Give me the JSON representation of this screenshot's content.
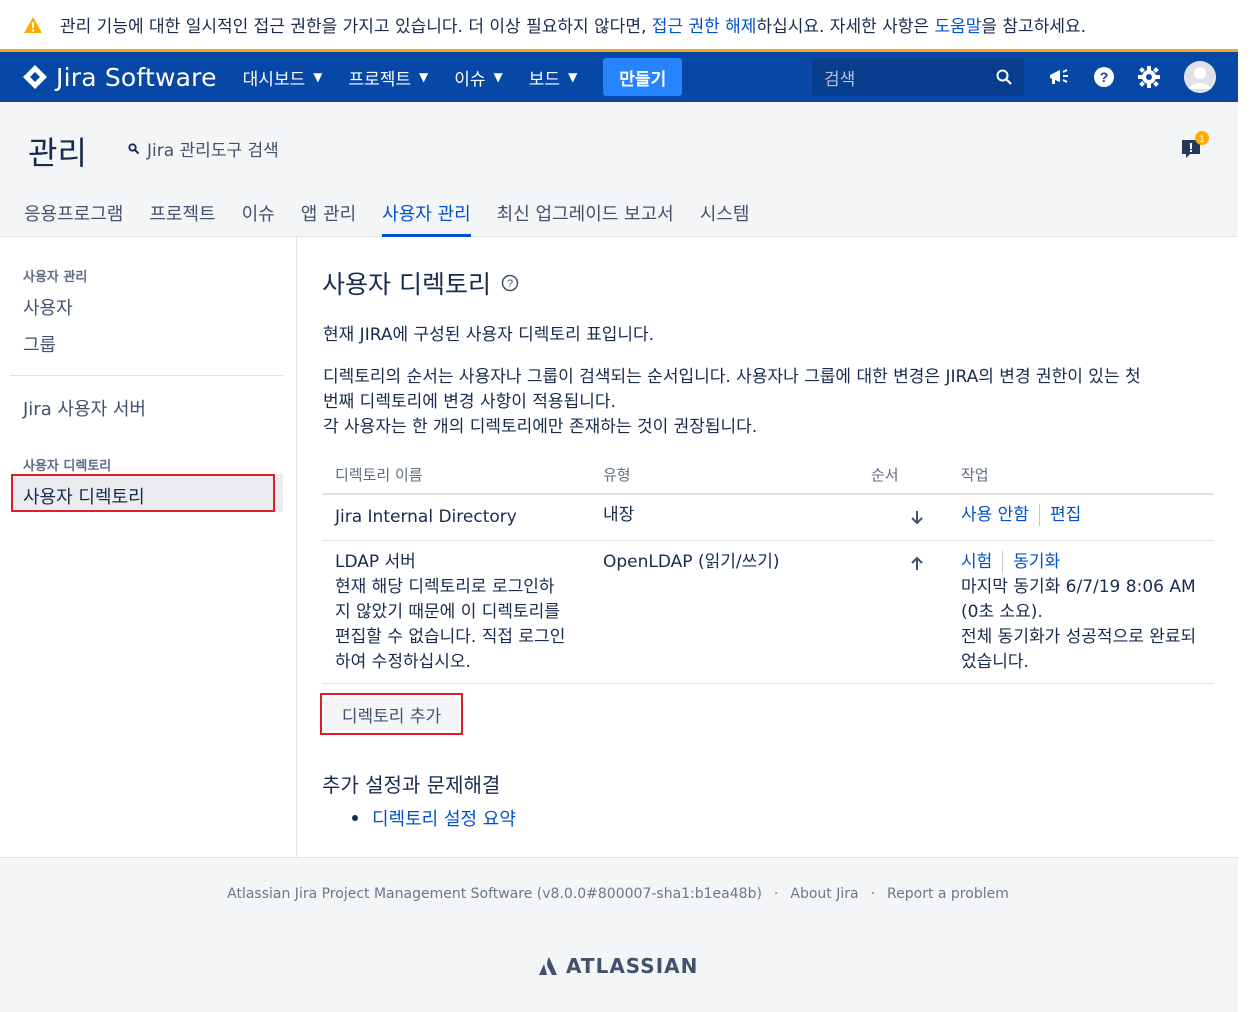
{
  "banner": {
    "text_before": "관리 기능에 대한 일시적인 접근 권한을 가지고 있습니다. 더 이상 필요하지 않다면, ",
    "link1": "접근 권한 해제",
    "text_mid": "하십시요. 자세한 사항은 ",
    "link2": "도움말",
    "text_after": "을 참고하세요."
  },
  "topnav": {
    "logo": "Jira Software",
    "items": [
      "대시보드",
      "프로젝트",
      "이슈",
      "보드"
    ],
    "create": "만들기",
    "search_placeholder": "검색"
  },
  "admin": {
    "title": "관리",
    "search": "Jira 관리도구 검색",
    "notification_count": "1",
    "tabs": [
      "응용프로그램",
      "프로젝트",
      "이슈",
      "앱 관리",
      "사용자 관리",
      "최신 업그레이드 보고서",
      "시스템"
    ],
    "active_tab": "사용자 관리"
  },
  "sidebar": {
    "section1_heading": "사용자 관리",
    "users": "사용자",
    "groups": "그룹",
    "jira_user_server": "Jira 사용자 서버",
    "section2_heading": "사용자 디렉토리",
    "user_directories": "사용자 디렉토리"
  },
  "main": {
    "title": "사용자 디렉토리",
    "intro": "현재 JIRA에 구성된 사용자 디렉토리 표입니다.",
    "desc_line1": "디렉토리의 순서는 사용자나 그룹이 검색되는 순서입니다. 사용자나 그룹에 대한 변경은 JIRA의 변경 권한이 있는 첫",
    "desc_line2": "번째 디렉토리에 변경 사항이 적용됩니다.",
    "desc_line3": "각 사용자는 한 개의 디렉토리에만 존재하는 것이 권장됩니다.",
    "table": {
      "headers": [
        "디렉토리 이름",
        "유형",
        "순서",
        "작업"
      ],
      "rows": [
        {
          "name": "Jira Internal Directory",
          "type": "내장",
          "order": "down",
          "action1": "사용 안함",
          "action2": "편집"
        },
        {
          "name": "LDAP 서버",
          "note": "현재 해당 디렉토리로 로그인하지 않았기 때문에 이 디렉토리를 편집할 수 없습니다. 직접 로그인하여 수정하십시오.",
          "type": "OpenLDAP (읽기/쓰기)",
          "order": "up",
          "action1": "시험",
          "action2": "동기화",
          "sync_info": "마지막 동기화 6/7/19 8:06 AM (0초 소요).",
          "sync_result": "전체 동기화가 성공적으로 완료되었습니다."
        }
      ]
    },
    "add_button": "디렉토리 추가",
    "settings_heading": "추가 설정과 문제해결",
    "settings_link": "디렉토리 설정 요약"
  },
  "footer": {
    "product": "Atlassian Jira Project Management Software (v8.0.0#800007-sha1:b1ea48b)",
    "about": "About Jira",
    "report": "Report a problem",
    "brand": "ATLASSIAN"
  },
  "colors": {
    "nav_bg": "#0747a6",
    "link": "#0052cc",
    "create_btn": "#2684ff",
    "highlight_border": "#e01e2b"
  }
}
